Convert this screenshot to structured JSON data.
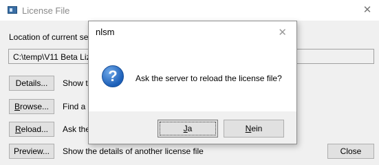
{
  "window": {
    "title": "License File",
    "close_glyph": "✕"
  },
  "location_label": "Location of current server",
  "license_path": "C:\\temp\\V11 Beta Lizenz",
  "actions": [
    {
      "label": "Details...",
      "mnemonic": "",
      "rest": "",
      "description": "Show the details of the current license file"
    },
    {
      "label": "",
      "mnemonic": "B",
      "rest": "rowse...",
      "description": "Find a different license file"
    },
    {
      "label": "",
      "mnemonic": "R",
      "rest": "eload...",
      "description": "Ask the server to reload the license file"
    },
    {
      "label": "Preview...",
      "mnemonic": "",
      "rest": "",
      "description": "Show the details of another license file"
    }
  ],
  "close_button": "Close",
  "dialog": {
    "title": "nlsm",
    "close_glyph": "✕",
    "icon": "question-icon",
    "message": "Ask the server to reload the license file?",
    "yes_mnemonic": "J",
    "yes_rest": "a",
    "no_mnemonic": "N",
    "no_rest": "ein"
  }
}
